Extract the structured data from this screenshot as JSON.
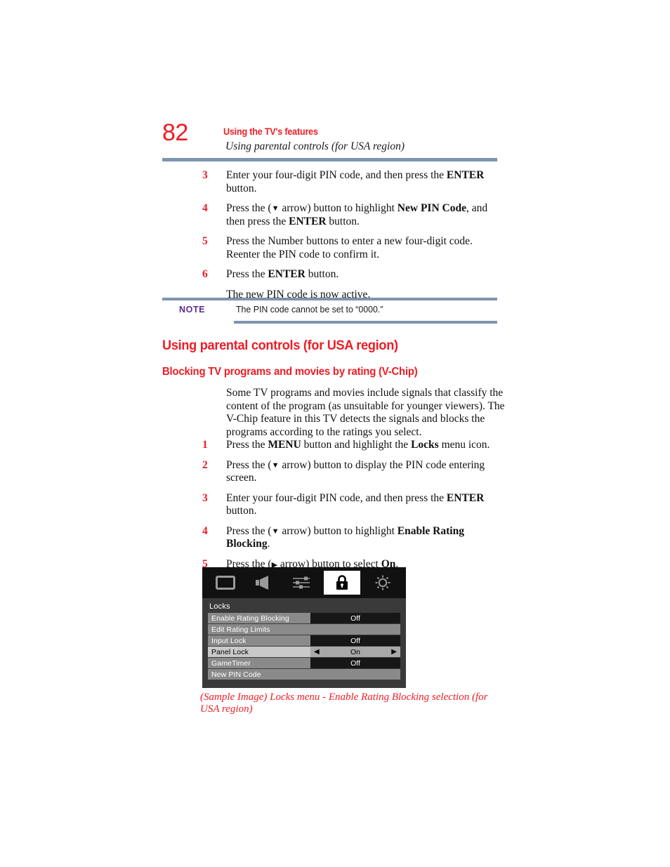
{
  "header": {
    "page_number": "82",
    "title": "Using the TV's features",
    "subtitle": "Using parental controls (for USA region)"
  },
  "steps_top": [
    {
      "num": "3",
      "html": "Enter your four-digit PIN code, and then press the <b>ENTER</b> button."
    },
    {
      "num": "4",
      "html": "Press the (<span class=\"arr\">&#9660;</span> arrow) button to highlight <b>New PIN Code</b>, and then press the <b>ENTER</b> button."
    },
    {
      "num": "5",
      "html": "Press the Number buttons to enter a new four-digit code. Reenter the PIN code to confirm it."
    },
    {
      "num": "6",
      "html": "Press the <b>ENTER</b> button."
    }
  ],
  "steps_top_trailing": "The new PIN code is now active.",
  "note": {
    "label": "NOTE",
    "text": "The PIN code cannot be set to “0000.”"
  },
  "headings": {
    "h1": "Using parental controls (for USA region)",
    "h2": "Blocking TV programs and movies by rating (V-Chip)"
  },
  "intro_paragraph": "Some TV programs and movies include signals that classify the content of the program (as unsuitable for younger viewers). The V-Chip feature in this TV detects the signals and blocks the programs according to the ratings you select.",
  "steps_bottom": [
    {
      "num": "1",
      "html": "Press the <b>MENU</b> button and highlight the <b>Locks</b> menu icon."
    },
    {
      "num": "2",
      "html": "Press the (<span class=\"arr\">&#9660;</span> arrow) button to display the PIN code entering screen."
    },
    {
      "num": "3",
      "html": "Enter your four-digit PIN code, and then press the <b>ENTER</b> button."
    },
    {
      "num": "4",
      "html": "Press the (<span class=\"arr\">&#9660;</span> arrow) button to highlight <b>Enable Rating Blocking</b>."
    },
    {
      "num": "5",
      "html": "Press the (<span class=\"arr-r\">&#9654;</span> arrow) button to select <b>On</b>."
    }
  ],
  "tv_menu": {
    "icons": [
      {
        "name": "picture-icon",
        "selected": false
      },
      {
        "name": "audio-speaker-icon",
        "selected": false
      },
      {
        "name": "sliders-icon",
        "selected": false
      },
      {
        "name": "lock-icon",
        "selected": true
      },
      {
        "name": "setup-sun-icon",
        "selected": false
      }
    ],
    "title": "Locks",
    "rows": [
      {
        "label": "Enable Rating Blocking",
        "value": "Off",
        "selected": false,
        "full": false,
        "arrows": false
      },
      {
        "label": "Edit Rating Limits",
        "value": "",
        "selected": false,
        "full": true,
        "arrows": false
      },
      {
        "label": "Input Lock",
        "value": "Off",
        "selected": false,
        "full": false,
        "arrows": false
      },
      {
        "label": "Panel Lock",
        "value": "On",
        "selected": true,
        "full": false,
        "arrows": true
      },
      {
        "label": "GameTimer",
        "value": "Off",
        "selected": false,
        "full": false,
        "arrows": false
      },
      {
        "label": "New PIN Code",
        "value": "",
        "selected": false,
        "full": true,
        "arrows": false
      }
    ],
    "arrow_left": "◀",
    "arrow_right": "▶"
  },
  "caption": "(Sample Image) Locks menu - Enable Rating Blocking selection (for USA region)",
  "colors": {
    "accent_red": "#ee1c25",
    "rule_blue": "#7e94b0",
    "note_purple": "#5b2d90"
  }
}
